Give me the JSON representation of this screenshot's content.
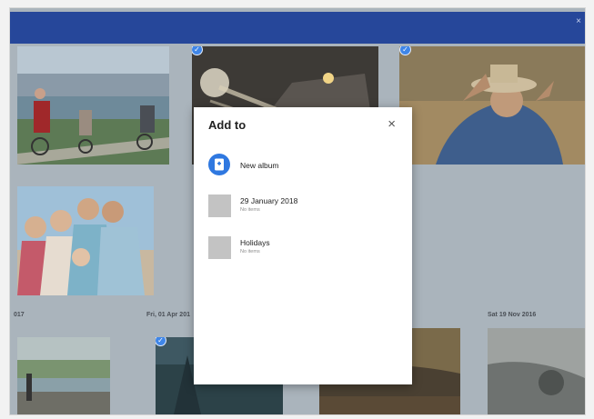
{
  "window": {
    "close_glyph": "×"
  },
  "timeline": {
    "date_labels": [
      "017",
      "Fri, 01 Apr 201",
      "Sat 19 Nov 2016"
    ]
  },
  "dialog": {
    "title": "Add to",
    "close_glyph": "×",
    "new_album_label": "New album",
    "albums": [
      {
        "title": "29 January 2018",
        "subtitle": "No items"
      },
      {
        "title": "Holidays",
        "subtitle": "No items"
      }
    ]
  },
  "colors": {
    "title_bar": "#26479a",
    "accent": "#2f78e0",
    "dim_overlay": "#aab4bc"
  },
  "icons": [
    "close-icon",
    "checkmark-icon",
    "album-add-icon"
  ]
}
